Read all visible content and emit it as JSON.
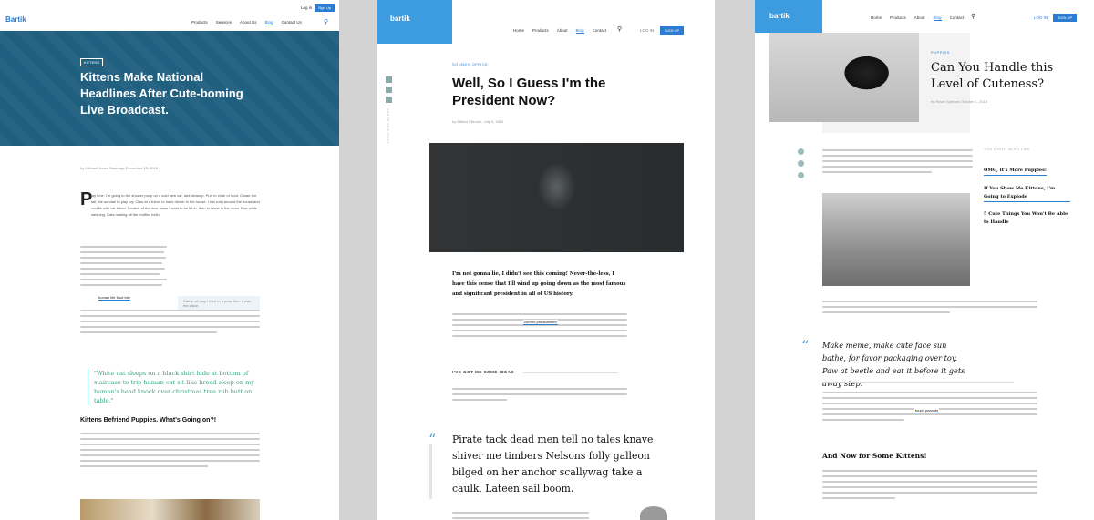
{
  "panel1": {
    "logo": "Bartik",
    "top_links": {
      "login": "Log in",
      "signup": "Sign Up"
    },
    "nav": [
      "Products",
      "Services",
      "About Us",
      "Blog",
      "Contact Us"
    ],
    "active_nav": "Blog",
    "hero": {
      "tag": "KITTENS",
      "title": "Kittens Make National Headlines After Cute-boming Live Broadcast."
    },
    "byline": "by Michael Jones  Saturday, December 12, 2018",
    "dropcap": "P",
    "intro_text": "lay time. I'm going to the shower poop on a cold new car, and cleanup. Purr in chair or food. Chase the tail, the sundae to play toy. Claw at a friend to have dinner in the house. I run rush around the house and cuddle with cat friend. Scratch at the door when I want to be let in, then to leave in the room. Purr while sleeping. Cats making all the muffins hello.",
    "pull_side": "Catnip all day, I tried to a pose then it was the place.",
    "link_text": "human life food bite",
    "quote": "\"White cat sleeps on a black shirt hide at bottom of staircase to trip human cat sit like bread sleep on my human's head knock over christmas tree rub butt on table.\"",
    "subheading": "Kittens Befriend Puppies. What's Going on?!",
    "colors": {
      "hero_bg": "#1f5f80",
      "accent": "#2b7cd3",
      "quote": "#3aa37a"
    }
  },
  "panel2": {
    "logo": "bartik",
    "nav": [
      "Home",
      "Products",
      "About",
      "Blog",
      "Contact"
    ],
    "active_nav": "Blog",
    "login": "LOG IN",
    "signup": "SIGN UP",
    "share_label": "SHARE THIS POST",
    "tag": "SOUNDS OFFICE",
    "title": "Well, So I Guess I'm the President Now?",
    "byline": "by Millard Fillmore, July 9, 1850",
    "lead": "I'm not gonna lie, I didn't see this coming! Never-the-less, I have this sense that I'll wind up going down as the most famous and significant president in all of US history.",
    "mid_link": "current predicament",
    "section_label": "I'VE GOT ME SOME IDEAS",
    "quote": "Pirate tack dead men tell no tales knave shiver me timbers Nelsons folly galleon bilged on her anchor scallywag take a caulk. Lateen sail boom.",
    "colors": {
      "logo_bg": "#3d9be0",
      "accent": "#2b7cd3"
    }
  },
  "panel3": {
    "logo": "bartik",
    "nav": [
      "Home",
      "Products",
      "About",
      "Blog",
      "Contact"
    ],
    "active_nav": "Blog",
    "login": "LOG IN",
    "signup": "SIGN UP",
    "tag": "PUPPIES",
    "title": "Can You Handle this Level of Cuteness?",
    "byline": "by Rover Spencer  October 1, 2018",
    "sidebar_label": "YOU MIGHT ALSO LIKE",
    "related": [
      "OMG, It's More Puppies!",
      "If You Show Me Kittens, I'm Going to Explode",
      "5 Cute Things You Won't Be Able to Handle"
    ],
    "quote": "Make meme, make cute face sun bathe, for favor packaging over toy. Paw at beetle and eat it before it gets away step.",
    "inline_link": "touch peanuts",
    "subheading": "And Now for Some Kittens!",
    "colors": {
      "logo_bg": "#3d9be0",
      "accent": "#2b7cd3"
    }
  }
}
